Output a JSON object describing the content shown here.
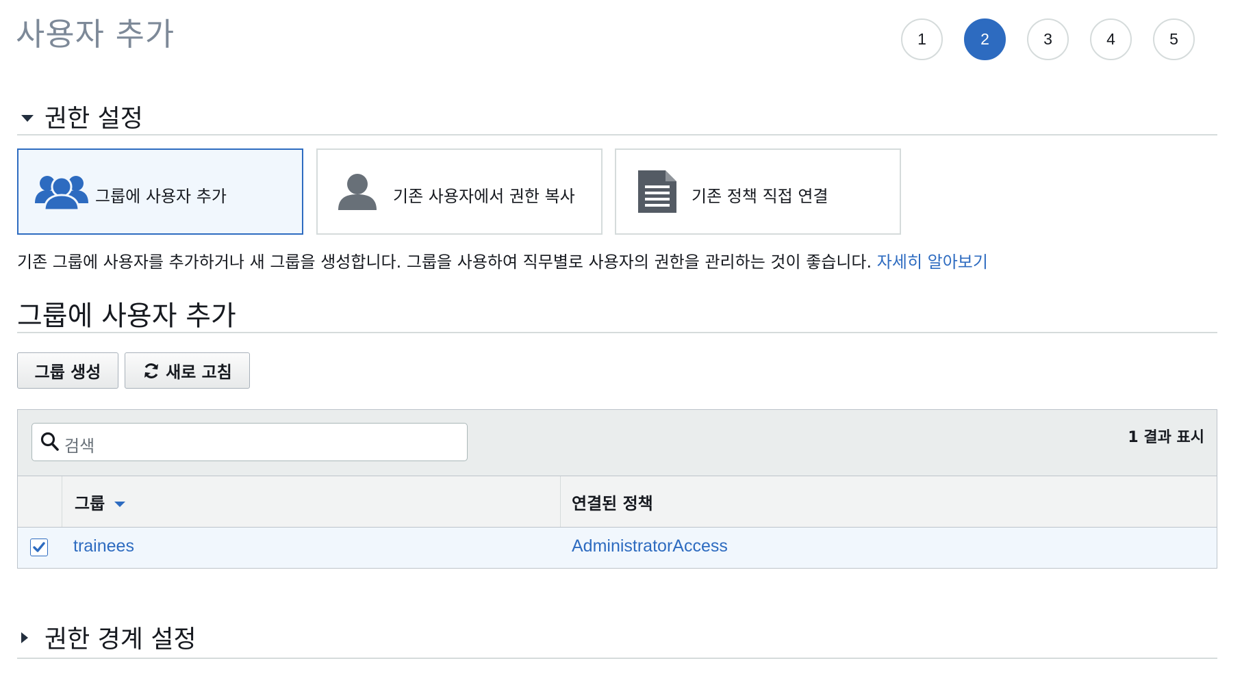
{
  "page_title": "사용자 추가",
  "steps": [
    "1",
    "2",
    "3",
    "4",
    "5"
  ],
  "active_step": "2",
  "permissions": {
    "title": "권한 설정",
    "options": [
      {
        "label": "그룹에 사용자 추가",
        "icon": "users-group-icon",
        "selected": true
      },
      {
        "label": "기존 사용자에서 권한 복사",
        "icon": "user-icon",
        "selected": false
      },
      {
        "label": "기존 정책 직접 연결",
        "icon": "document-icon",
        "selected": false
      }
    ],
    "description": "기존 그룹에 사용자를 추가하거나 새 그룹을 생성합니다. 그룹을 사용하여 직무별로 사용자의 권한을 관리하는 것이 좋습니다.",
    "learn_more": "자세히 알아보기"
  },
  "add_to_group": {
    "title": "그룹에 사용자 추가",
    "create_button": "그룹 생성",
    "refresh_button": "새로 고침",
    "search_placeholder": "검색",
    "result_count": "1 결과 표시",
    "columns": {
      "group": "그룹",
      "policy": "연결된 정책"
    },
    "rows": [
      {
        "checked": true,
        "group": "trainees",
        "policy": "AdministratorAccess"
      }
    ]
  },
  "boundary": {
    "title": "권한 경계 설정"
  },
  "colors": {
    "accent": "#2d6bc0",
    "selected_bg": "#f1f7fd",
    "title_gray": "#7d8998"
  }
}
